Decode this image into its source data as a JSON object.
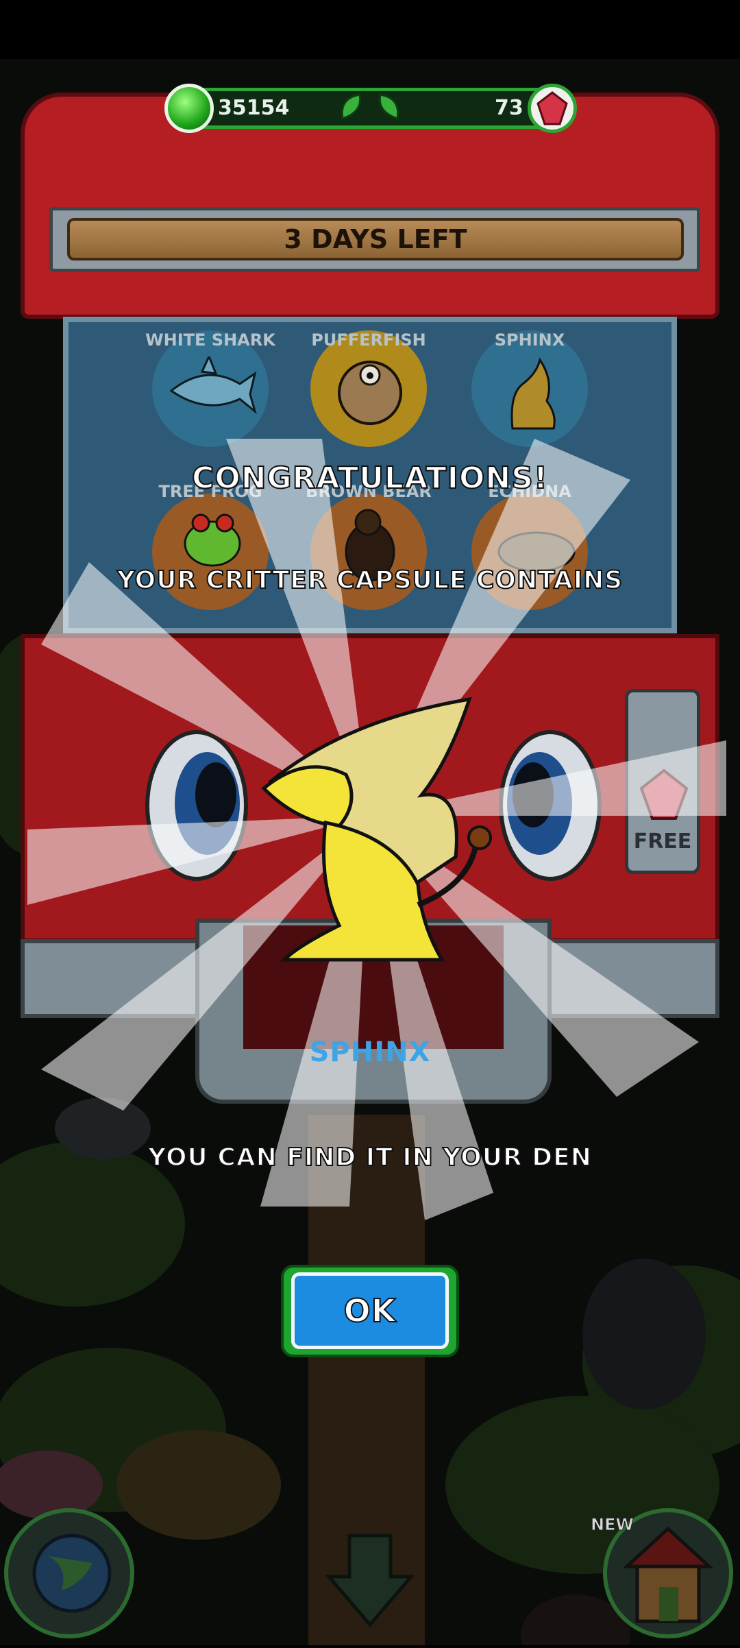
{
  "currency": {
    "gems": "35154",
    "crystals": "73"
  },
  "machine": {
    "timer": "3 DAYS LEFT",
    "free_label": "FREE",
    "critters": [
      {
        "name": "WHITE SHARK",
        "color": "#2f6f8f"
      },
      {
        "name": "PUFFERFISH",
        "color": "#b08a1a"
      },
      {
        "name": "SPHINX",
        "color": "#2f6f8f"
      },
      {
        "name": "TREE FROG",
        "color": "#9a5a26"
      },
      {
        "name": "BROWN BEAR",
        "color": "#9a5a26"
      },
      {
        "name": "ECHIDNA",
        "color": "#9a5a26"
      }
    ]
  },
  "reward": {
    "title": "CONGRATULATIONS!",
    "subtitle": "YOUR CRITTER CAPSULE CONTAINS",
    "critter_name": "SPHINX",
    "den_message": "YOU CAN FIND IT IN YOUR DEN",
    "ok_label": "OK"
  },
  "nav": {
    "new_badge": "NEW"
  }
}
